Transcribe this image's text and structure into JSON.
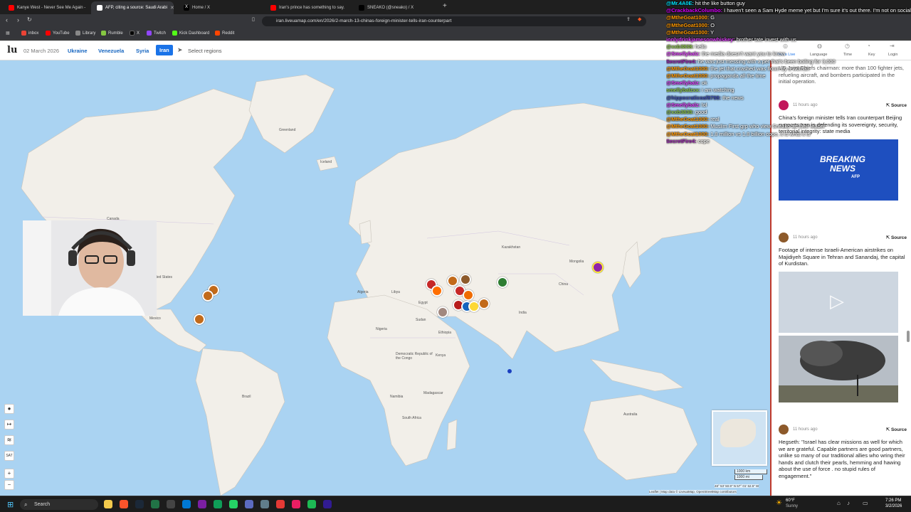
{
  "browser": {
    "tabs": [
      {
        "label": "Kanye West - Never See Me Again -",
        "fav_color": "#ff0000"
      },
      {
        "label": "AFP, citing a source: Saudi Arabi",
        "fav_color": "#ffffff"
      },
      {
        "label": "Home / X",
        "fav_color": "#000000"
      },
      {
        "label": "Iran's prince has something to say.",
        "fav_color": "#ff0000"
      },
      {
        "label": "SNEAKO (@sneako) / X",
        "fav_color": "#000000"
      }
    ],
    "url": "iran.liveuamap.com/en/2026/2-march-13-chinas-foreign-minister-tells-iran-counterpart",
    "bookmarks": [
      {
        "label": "inbox",
        "color": "#ea4335"
      },
      {
        "label": "YouTube",
        "color": "#ff0000"
      },
      {
        "label": "Library",
        "color": "#888888"
      },
      {
        "label": "Rumble",
        "color": "#85c742"
      },
      {
        "label": "X",
        "color": "#000000"
      },
      {
        "label": "Twitch",
        "color": "#9146ff"
      },
      {
        "label": "Kick Dashboard",
        "color": "#53fc18"
      },
      {
        "label": "Reddit",
        "color": "#ff4500"
      }
    ]
  },
  "header": {
    "logo": "lu",
    "date": "02 March 2026",
    "regions": [
      "Ukraine",
      "Venezuela",
      "Syria",
      "Iran"
    ],
    "active_region": "Iran",
    "select_regions": "Select regions",
    "right_nav": [
      "News Live",
      "Language",
      "Time",
      "Key",
      "Login"
    ]
  },
  "map": {
    "labels": {
      "greenland": "Greenland",
      "iceland": "Iceland",
      "kazakhstan": "Kazakhstan",
      "china": "China",
      "india": "India",
      "australia": "Australia",
      "mongolia": "Mongolia",
      "united_states": "United States",
      "canada": "Canada",
      "algeria": "Algeria",
      "egypt": "Egypt",
      "kenya": "Kenya",
      "mexico": "Mexico",
      "brazil": "Brazil",
      "dr_congo": "Democratic Republic of the Congo",
      "madagascar": "Madagascar",
      "sudan": "Sudan",
      "libya": "Libya",
      "nigeria": "Nigeria",
      "namibia": "Namibia",
      "south_africa": "South Africa",
      "ethiopia": "Ethiopia"
    },
    "scale": [
      "1000 km",
      "1000 mi"
    ],
    "coords": "48° 53' 50.9\" N 57° 01' 52.5\" W",
    "attribution": "Leaflet | Map data © LiveuaMap, OpenStreetMap contributors",
    "controls": [
      "+",
      "−"
    ]
  },
  "sidebar": {
    "top_text": "US Joint Chiefs chairman: more than 100 fighter jets, refueling aircraft, and bombers participated in the initial operation.",
    "items": [
      {
        "time": "11 hours ago",
        "source": "Source",
        "text": "China's foreign minister tells Iran counterpart Beijing supports Iran in defending its sovereignty, security, territorial integrity: state media",
        "image_caption": "BREAKING NEWS",
        "image_sub": "AFP",
        "avatar_color": "#c2185b"
      },
      {
        "time": "11 hours ago",
        "source": "Source",
        "text": "Footage of intense Israeli-American airstrikes on Majidiyeh Square in Tehran and Sanandaj, the capital of Kurdistan.",
        "avatar_color": "#8d5a2b"
      },
      {
        "time": "11 hours ago",
        "source": "Source",
        "text": "Hegseth: \"Israel has clear missions as well for which we are grateful. Capable partners are good partners, unlike so many of our traditional allies who wring their hands and clutch their pearls, hemming and hawing about the use of force . no stupid rules of engagement.\"",
        "avatar_color": "#8d5a2b"
      }
    ]
  },
  "chat": [
    {
      "user": "@Mr.4A0E:",
      "color": "#00e5ff",
      "msg": " hit the like button guy"
    },
    {
      "user": "@CrackbackColumbo:",
      "color": "#d500f9",
      "msg": " I haven't seen a Sam Hyde meme yet but I'm sure it's out there. I'm not on social media so there's that."
    },
    {
      "user": "@MtheGoat1000:",
      "color": "#ff9800",
      "msg": " G"
    },
    {
      "user": "@MtheGoat1000:",
      "color": "#ff9800",
      "msg": " O"
    },
    {
      "user": "@MtheGoat1000:",
      "color": "#ff9800",
      "msg": " Y"
    },
    {
      "user": "ionlydrinkjamesonwhiskey:",
      "color": "#e040fb",
      "msg": " brother tate invest with us"
    },
    {
      "user": "@xxb3838:",
      "color": "#8bc34a",
      "msg": " hello"
    },
    {
      "user": "@Smellybalz:",
      "color": "#e040fb",
      "msg": " the media doesn't want you to know"
    },
    {
      "user": "SecretFire4:",
      "color": "#9c27b0",
      "msg": " he was just messing with a pet that's been boiling for 3,000"
    },
    {
      "user": "@MtheGoat1000:",
      "color": "#ff9800",
      "msg": " the jet that crashed was flown by a woman"
    },
    {
      "user": "@MtheGoat1000:",
      "color": "#ff9800",
      "msg": " propaganda all the time"
    },
    {
      "user": "@Smellybalz:",
      "color": "#e040fb",
      "msg": " ok"
    },
    {
      "user": "smellybalzxx:",
      "color": "#8bc34a",
      "msg": " i am watching"
    },
    {
      "user": "@hippocraticoaf8798:",
      "color": "#3f51b5",
      "msg": " the news"
    },
    {
      "user": "@Smellybalz:",
      "color": "#e040fb",
      "msg": " lol"
    },
    {
      "user": "@xxb3838:",
      "color": "#8bc34a",
      "msg": " good"
    },
    {
      "user": "@MtheGoat1000:",
      "color": "#ff9800",
      "msg": " real"
    },
    {
      "user": "@MtheGoat1000:",
      "color": "#ff9800",
      "msg": " Muslim First grp who view Sneako as their leader"
    },
    {
      "user": "@MtheGoat1000:",
      "color": "#ff9800",
      "msg": " 1.8 million vs 1.8 billion cope, it is what it is"
    },
    {
      "user": "SecretFire4:",
      "color": "#9c27b0",
      "msg": " cope"
    }
  ],
  "taskbar": {
    "search": "Search",
    "weather_temp": "60°F",
    "weather_desc": "Sunny",
    "time": "7:26 PM",
    "date": "3/2/2026"
  }
}
